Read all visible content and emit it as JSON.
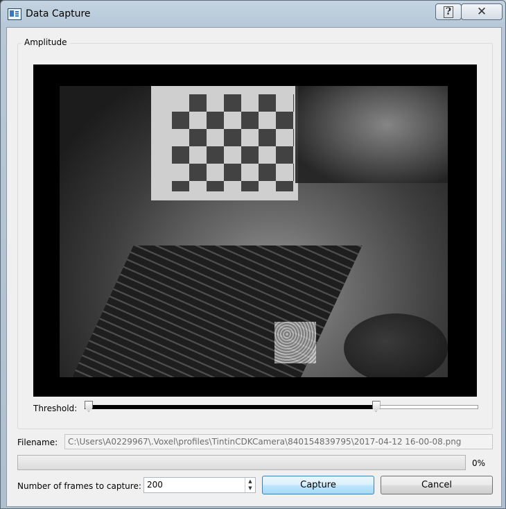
{
  "window": {
    "title": "Data Capture"
  },
  "group": {
    "title": "Amplitude"
  },
  "threshold": {
    "label": "Threshold:",
    "low": 0.0,
    "high": 0.75
  },
  "filename": {
    "label": "Filename:",
    "value": "C:\\Users\\A0229967\\.Voxel\\profiles\\TintinCDKCamera\\840154839795\\2017-04-12 16-00-08.png"
  },
  "progress": {
    "value": 0,
    "text": "0%"
  },
  "frames": {
    "label": "Number of frames to capture:",
    "value": "200"
  },
  "buttons": {
    "capture": "Capture",
    "cancel": "Cancel"
  },
  "titlebar": {
    "help": "?",
    "close": "✕"
  }
}
